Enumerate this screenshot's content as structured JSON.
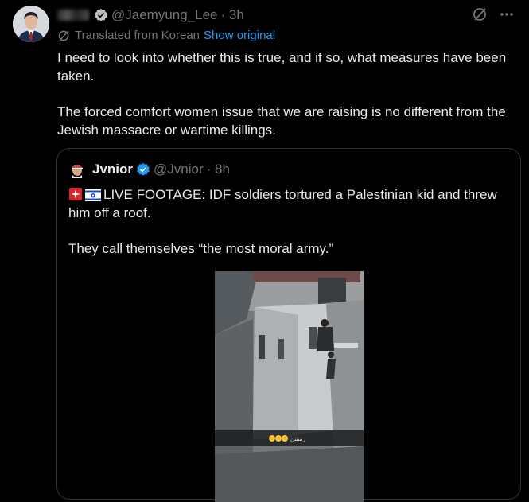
{
  "tweet": {
    "handle": "@Jaemyung_Lee",
    "time": "· 3h",
    "translated_label": "Translated from Korean",
    "show_original": "Show original",
    "paragraphs": [
      "I need to look into whether this is true, and if so, what measures have been taken.",
      "The forced comfort women issue that we are raising is no different from the Jewish massacre or wartime killings."
    ]
  },
  "quoted": {
    "name": "Jvnior",
    "handle": "@Jvnior",
    "time": "· 8h",
    "line1": "LIVE FOOTAGE: IDF soldiers tortured a Palestinian kid and threw him off a roof.",
    "line2": "They call themselves “the most moral army.”",
    "emojis": [
      "siren-emoji",
      "israel-flag-emoji"
    ],
    "video_caption": "زنننننن"
  },
  "icons": {
    "verified": "verified-badge-icon",
    "grok": "grok-icon",
    "more": "more-icon",
    "translate": "translate-icon"
  },
  "colors": {
    "background": "#000000",
    "text": "#e7e9ea",
    "muted": "#71767b",
    "link": "#1d9bf0",
    "border": "#2f3336"
  }
}
